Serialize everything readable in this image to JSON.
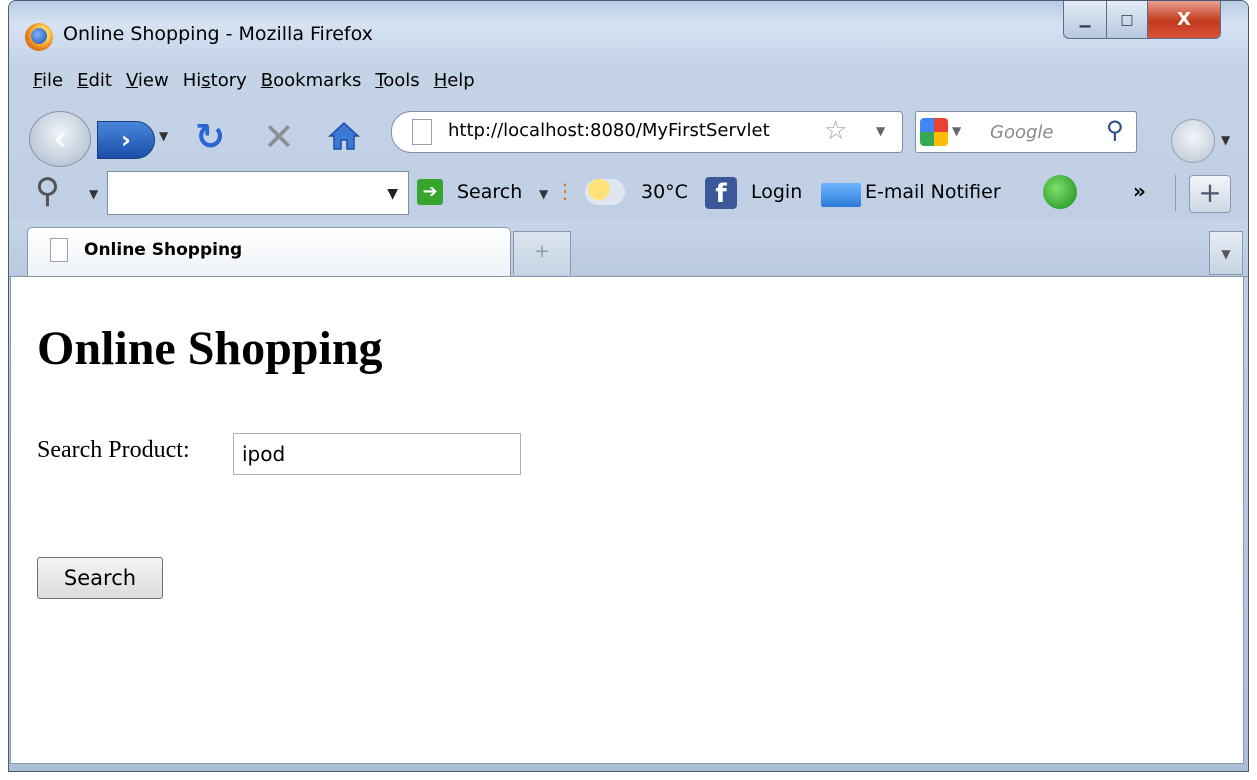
{
  "window": {
    "title": "Online Shopping - Mozilla Firefox",
    "close_glyph": "X"
  },
  "menu": [
    "File",
    "Edit",
    "View",
    "History",
    "Bookmarks",
    "Tools",
    "Help"
  ],
  "menu_access_keys": [
    "F",
    "E",
    "V",
    "s",
    "B",
    "T",
    "H"
  ],
  "nav": {
    "url": "http://localhost:8080/MyFirstServlet",
    "search_engine_placeholder": "Google"
  },
  "toolbar": {
    "search_label": "Search",
    "temperature": "30°C",
    "facebook_label": "Login",
    "email_label": "E-mail Notifier",
    "overflow_glyph": "»"
  },
  "tabs": {
    "active_label": "Online Shopping"
  },
  "page": {
    "heading": "Online Shopping",
    "product_label": "Search Product:",
    "product_value": "ipod",
    "submit_label": "Search"
  },
  "colors": {
    "chrome_blue": "#c7d5e8",
    "close_red": "#c23a1e",
    "forward_blue": "#1a4fa8"
  }
}
